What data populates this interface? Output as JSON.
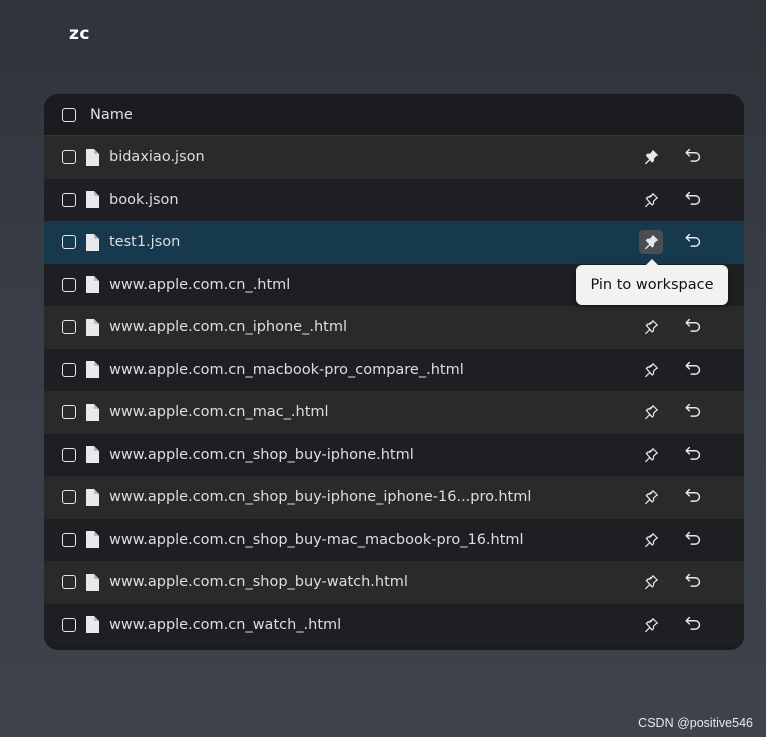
{
  "workspace": {
    "title": "zc"
  },
  "table": {
    "header": {
      "name_label": "Name"
    },
    "rows": [
      {
        "name": "bidaxiao.json",
        "pinned": true,
        "selected": false
      },
      {
        "name": "book.json",
        "pinned": false,
        "selected": false
      },
      {
        "name": "test1.json",
        "pinned": true,
        "selected": true
      },
      {
        "name": "www.apple.com.cn_.html",
        "pinned": false,
        "selected": false
      },
      {
        "name": "www.apple.com.cn_iphone_.html",
        "pinned": false,
        "selected": false
      },
      {
        "name": "www.apple.com.cn_macbook-pro_compare_.html",
        "pinned": false,
        "selected": false
      },
      {
        "name": "www.apple.com.cn_mac_.html",
        "pinned": false,
        "selected": false
      },
      {
        "name": "www.apple.com.cn_shop_buy-iphone.html",
        "pinned": false,
        "selected": false
      },
      {
        "name": "www.apple.com.cn_shop_buy-iphone_iphone-16...pro.html",
        "pinned": false,
        "selected": false
      },
      {
        "name": "www.apple.com.cn_shop_buy-mac_macbook-pro_16.html",
        "pinned": false,
        "selected": false
      },
      {
        "name": "www.apple.com.cn_shop_buy-watch.html",
        "pinned": false,
        "selected": false
      },
      {
        "name": "www.apple.com.cn_watch_.html",
        "pinned": false,
        "selected": false
      }
    ]
  },
  "tooltip": {
    "text": "Pin to workspace"
  },
  "watermark": {
    "text": "CSDN @positive546"
  },
  "icons": {
    "file": "file-icon",
    "pin": "pin-icon",
    "restore": "undo-icon"
  },
  "colors": {
    "selected_row": "#17394d",
    "panel": "#1b1c1f"
  }
}
